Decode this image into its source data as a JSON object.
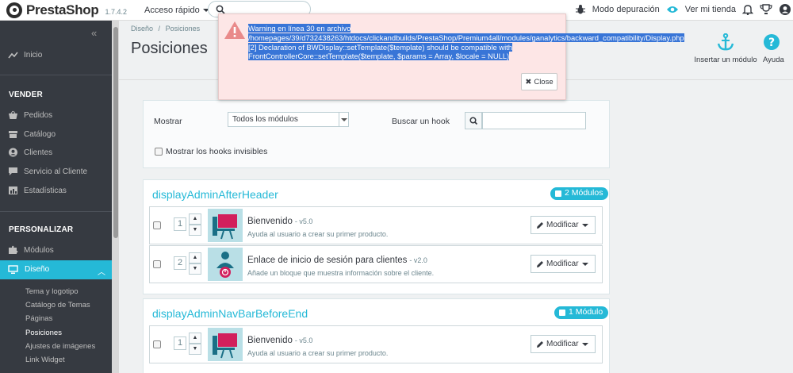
{
  "header": {
    "brand": "PrestaShop",
    "version": "1.7.4.2",
    "quick_access": "Acceso rápido",
    "debug_mode": "Modo depuración",
    "view_store": "Ver mi tienda"
  },
  "sidebar": {
    "home": "Inicio",
    "sections": {
      "sell": "VENDER",
      "customize": "PERSONALIZAR"
    },
    "sell_items": [
      "Pedidos",
      "Catálogo",
      "Clientes",
      "Servicio al Cliente",
      "Estadísticas"
    ],
    "modules": "Módulos",
    "design": "Diseño",
    "design_sub": [
      "Tema y logotipo",
      "Catálogo de Temas",
      "Páginas",
      "Posiciones",
      "Ajustes de imágenes",
      "Link Widget"
    ]
  },
  "page": {
    "breadcrumb_parent": "Diseño",
    "breadcrumb_sep": "/",
    "breadcrumb_current": "Posiciones",
    "title": "Posiciones",
    "insert_module": "Insertar un módulo",
    "help": "Ayuda"
  },
  "filters": {
    "show_label": "Mostrar",
    "show_value": "Todos los módulos",
    "search_hook_label": "Buscar un hook",
    "search_hook_value": "",
    "invisible_hooks_label": "Mostrar los hooks invisibles"
  },
  "hooks": [
    {
      "name": "displayAdminAfterHeader",
      "badge": "2 Módulos",
      "modules": [
        {
          "position": "1",
          "name": "Bienvenido",
          "version": "- v5.0",
          "description": "Ayuda al usuario a crear su primer producto.",
          "action": "Modificar"
        },
        {
          "position": "2",
          "name": "Enlace de inicio de sesión para clientes",
          "version": "- v2.0",
          "description": "Añade un bloque que muestra información sobre el cliente.",
          "action": "Modificar"
        }
      ]
    },
    {
      "name": "displayAdminNavBarBeforeEnd",
      "badge": "1 Módulo",
      "modules": [
        {
          "position": "1",
          "name": "Bienvenido",
          "version": "- v5.0",
          "description": "Ayuda al usuario a crear su primer producto.",
          "action": "Modificar"
        }
      ]
    }
  ],
  "warning": {
    "lines": [
      "Warning en línea 30 en archivo",
      "/homepages/39/d732438263/htdocs/clickandbuilds/PrestaShop/Premium4all/modules/ganalytics/backward_compatibility/Display.php",
      "[2] Declaration of BWDisplay::setTemplate($template) should be compatible with",
      "FrontControllerCore::setTemplate($template, $params = Array, $locale = NULL)"
    ],
    "close": "Close"
  },
  "colors": {
    "accent": "#25b9d7",
    "sidebar": "#363a41",
    "warning_bg": "#fde6e6",
    "warning_icon": "#e98a8a",
    "selection": "#3875d7"
  }
}
